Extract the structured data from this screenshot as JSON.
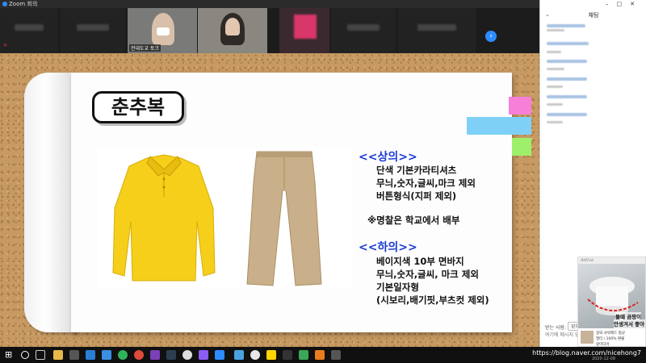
{
  "window": {
    "title": "Zoom 회의"
  },
  "video_strip": {
    "participant_label": "전대도교 토크",
    "next_icon": "›"
  },
  "slide": {
    "title": "춘추복",
    "top_section": {
      "heading": "<<상의>>",
      "lines": [
        "단색 기본카라티셔츠",
        "무늬,숫자,글씨,마크 제외",
        "버튼형식(지퍼 제외)"
      ]
    },
    "note": "※명찰은 학교에서 배부",
    "bottom_section": {
      "heading": "<<하의>>",
      "lines": [
        "베이지색 10부 면바지",
        "무늬,숫자,글씨, 마크 제외",
        "기본일자형",
        "(시보리,배기핏,부츠컷 제외)"
      ]
    },
    "colors": {
      "heading": "#1a3bd6",
      "tab_pink": "#f77fd8",
      "tab_blue": "#7fd0f7",
      "tab_green": "#9ef06a",
      "shirt": "#f5cf1a",
      "pants": "#c9b08a"
    }
  },
  "chat": {
    "title": "채팅",
    "to_label": "받는 사람:",
    "to_value": "모두",
    "input_placeholder": "여기에 메시지 입"
  },
  "ad": {
    "label": "AdVue",
    "headline_1": "물때 곰팡이",
    "headline_2": "안생겨서 좋아요!",
    "footer_1": "일락 샤워헤드 향균",
    "footer_2": "필터 / 100% 환불",
    "footer_3": "앞미디어"
  },
  "taskbar": {
    "url": "https://blog.naver.com/nicehong7",
    "date": "2020-12-08"
  }
}
